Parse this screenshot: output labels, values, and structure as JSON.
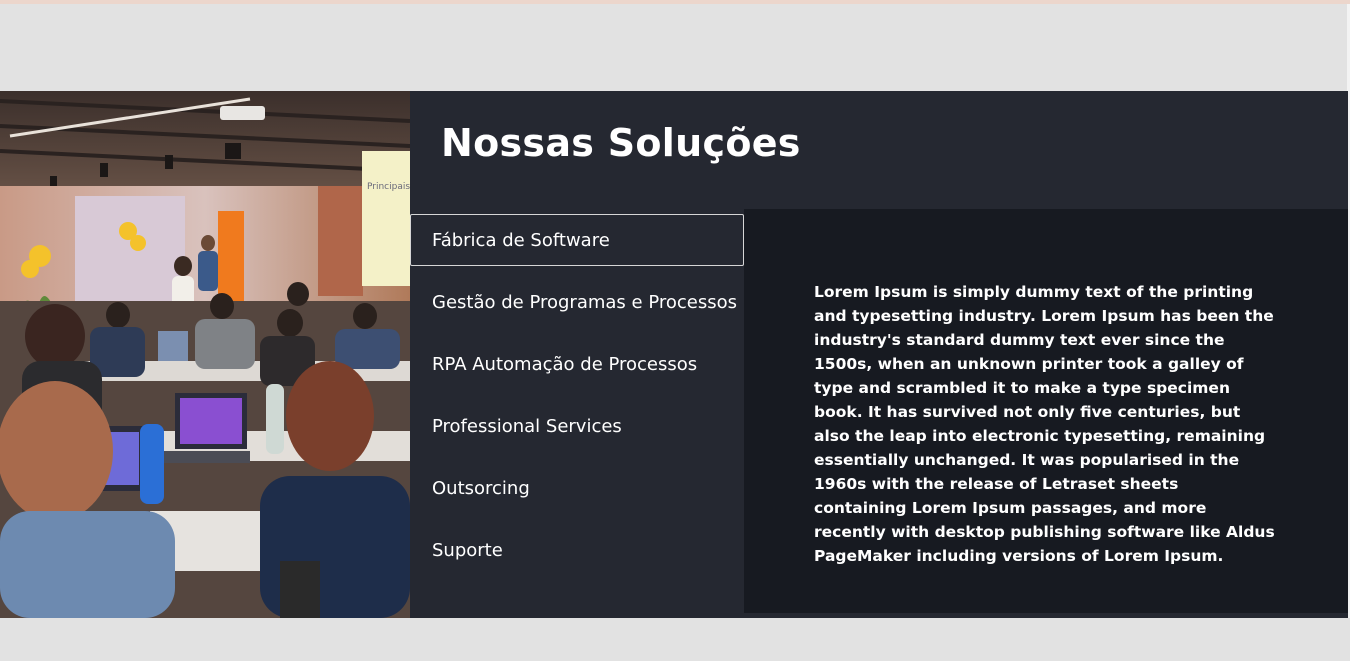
{
  "section": {
    "title": "Nossas Soluções",
    "tabs": [
      {
        "label": "Fábrica de Software",
        "active": true
      },
      {
        "label": "Gestão de Programas e Processos",
        "active": false
      },
      {
        "label": "RPA Automação de Processos",
        "active": false
      },
      {
        "label": "Professional Services",
        "active": false
      },
      {
        "label": "Outsorcing",
        "active": false
      },
      {
        "label": "Suporte",
        "active": false
      }
    ],
    "content": "Lorem Ipsum is simply dummy text of the printing and typesetting industry. Lorem Ipsum has been the industry's standard dummy text ever since the 1500s, when an unknown printer took a galley of type and scrambled it to make a type specimen book. It has survived not only five centuries, but also the leap into electronic typesetting, remaining essentially unchanged. It was popularised in the 1960s with the release of Letraset sheets containing Lorem Ipsum passages, and more recently with desktop publishing software like Aldus PageMaker including versions of Lorem Ipsum.",
    "photo_board_text": "Principais fatores de risco:"
  },
  "colors": {
    "page_background": "#e2e2e2",
    "section_background": "#252831",
    "panel_background": "#171a21",
    "text": "#ffffff",
    "active_tab_border": "#d6d6d6"
  }
}
